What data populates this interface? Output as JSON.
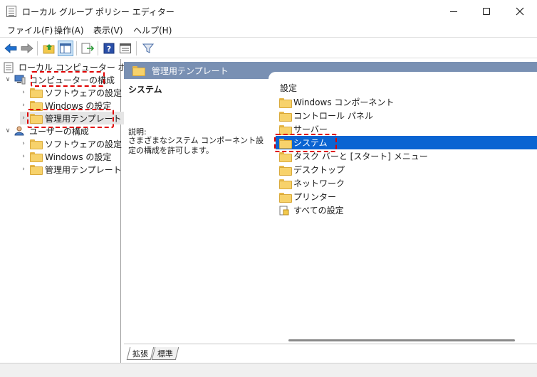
{
  "window": {
    "title": "ローカル グループ ポリシー エディター",
    "controls": [
      "minimize-icon",
      "maximize-icon",
      "close-icon"
    ]
  },
  "menu": [
    "ファイル(F)",
    "操作(A)",
    "表示(V)",
    "ヘルプ(H)"
  ],
  "toolbar": {
    "buttons": [
      "back-arrow-icon",
      "forward-arrow-icon",
      "up-folder-icon",
      "show-hide-tree-icon",
      "export-list-icon",
      "help-icon",
      "properties-view-icon",
      "filter-icon"
    ]
  },
  "tree": {
    "root": "ローカル コンピューター ポリシー",
    "computer_config": "コンピューターの構成",
    "computer_children": [
      "ソフトウェアの設定",
      "Windows の設定",
      "管理用テンプレート"
    ],
    "user_config": "ユーザーの構成",
    "user_children": [
      "ソフトウェアの設定",
      "Windows の設定",
      "管理用テンプレート"
    ]
  },
  "right": {
    "header": "管理用テンプレート",
    "desc_title": "システム",
    "desc_label": "説明:",
    "desc_text": "さまざまなシステム コンポーネント設定の構成を許可します。",
    "list_header": "設定",
    "items": [
      "Windows コンポーネント",
      "コントロール パネル",
      "サーバー",
      "システム",
      "タスク バーと [スタート] メニュー",
      "デスクトップ",
      "ネットワーク",
      "プリンター",
      "すべての設定"
    ],
    "selected_item": "システム"
  },
  "tabs": [
    "拡張",
    "標準"
  ],
  "colors": {
    "header_bg": "#7990b3",
    "selection": "#0a64d2",
    "highlight_border": "#e00000",
    "folder": "#f7d26b"
  }
}
